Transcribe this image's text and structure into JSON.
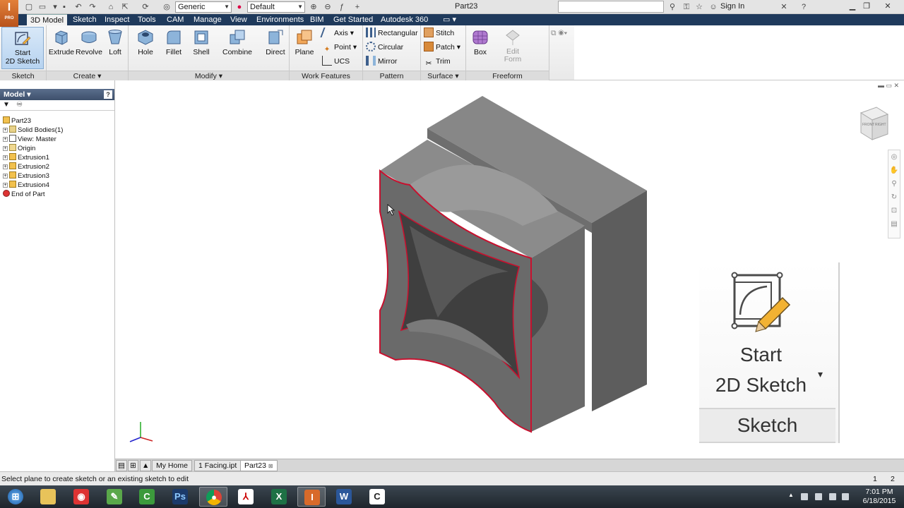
{
  "titlebar": {
    "logo_letter": "I",
    "logo_sub": "PRO",
    "appearance_combo": "Generic",
    "material_combo": "Default",
    "doc_title": "Part23",
    "signin": "Sign In"
  },
  "ribbon_tabs": [
    "3D Model",
    "Sketch",
    "Inspect",
    "Tools",
    "CAM",
    "Manage",
    "View",
    "Environments",
    "BIM",
    "Get Started",
    "Autodesk 360"
  ],
  "ribbon": {
    "sketch": {
      "button": "Start\n2D Sketch",
      "title": "Sketch"
    },
    "create": {
      "extrude": "Extrude",
      "revolve": "Revolve",
      "loft": "Loft",
      "title": "Create"
    },
    "modify": {
      "hole": "Hole",
      "fillet": "Fillet",
      "shell": "Shell",
      "combine": "Combine",
      "direct": "Direct",
      "title": "Modify"
    },
    "work_features": {
      "plane": "Plane",
      "axis": "Axis",
      "point": "Point",
      "ucs": "UCS",
      "title": "Work Features"
    },
    "pattern": {
      "rectangular": "Rectangular",
      "circular": "Circular",
      "mirror": "Mirror",
      "title": "Pattern"
    },
    "surface": {
      "stitch": "Stitch",
      "patch": "Patch",
      "trim": "Trim",
      "title": "Surface"
    },
    "freeform": {
      "box": "Box",
      "edit_form": "Edit\nForm",
      "title": "Freeform"
    }
  },
  "browser": {
    "title": "Model",
    "items": [
      "Part23",
      "Solid Bodies(1)",
      "View: Master",
      "Origin",
      "Extrusion1",
      "Extrusion2",
      "Extrusion3",
      "Extrusion4",
      "End of Part"
    ]
  },
  "viewcube": {
    "front": "FRONT",
    "right": "RIGHT"
  },
  "callout": {
    "line1": "Start",
    "line2": "2D Sketch",
    "panel": "Sketch"
  },
  "doc_tabs": [
    "My Home",
    "1 Facing.ipt",
    "Part23"
  ],
  "status": {
    "message": "Select plane to create sketch or an existing sketch to edit",
    "num1": "1",
    "num2": "2"
  },
  "taskbar": {
    "clock_time": "7:01 PM",
    "clock_date": "6/18/2015"
  }
}
